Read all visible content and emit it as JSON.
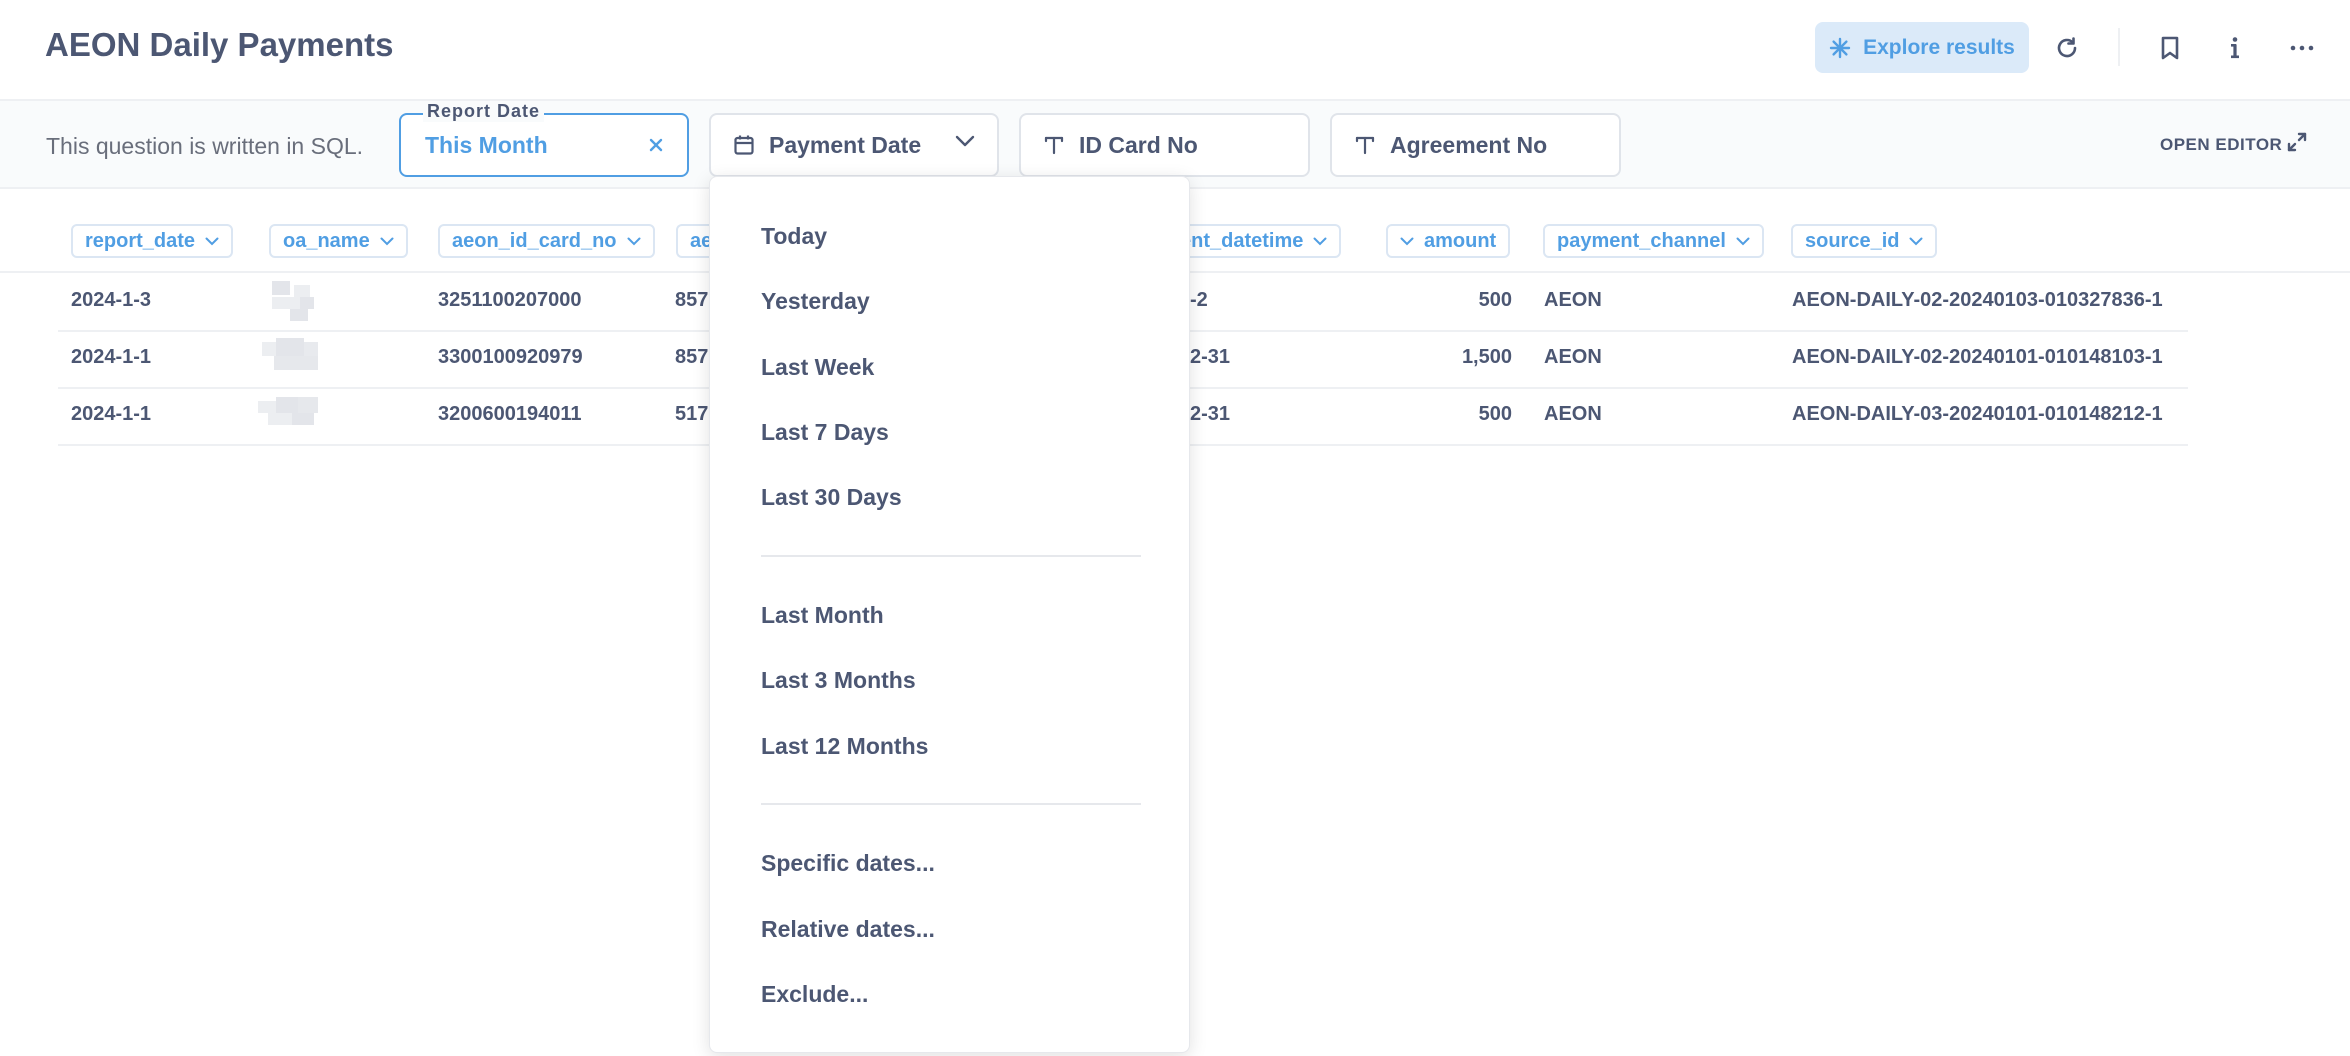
{
  "header": {
    "title": "AEON Daily Payments",
    "explore_label": "Explore results",
    "accent": "#509ee3"
  },
  "sqlbar": {
    "text": "This question is written in SQL.",
    "open_editor": "OPEN EDITOR",
    "filters": {
      "report_date": {
        "label": "Report Date",
        "value": "This Month"
      },
      "payment_date": {
        "label": "Payment Date"
      },
      "id_card": {
        "label": "ID Card No"
      },
      "agreement": {
        "label": "Agreement No"
      }
    }
  },
  "table": {
    "columns": [
      "report_date",
      "oa_name",
      "aeon_id_card_no",
      "ae",
      "ent_datetime",
      "amount",
      "payment_channel",
      "source_id"
    ],
    "rows": [
      {
        "report_date": "2024-1-3",
        "id_card": "3251100207000",
        "ae": "857",
        "datetime": "-2",
        "amount": "500",
        "channel": "AEON",
        "source_id": "AEON-DAILY-02-20240103-010327836-1"
      },
      {
        "report_date": "2024-1-1",
        "id_card": "3300100920979",
        "ae": "857",
        "datetime": "2-31",
        "amount": "1,500",
        "channel": "AEON",
        "source_id": "AEON-DAILY-02-20240101-010148103-1"
      },
      {
        "report_date": "2024-1-1",
        "id_card": "3200600194011",
        "ae": "517",
        "datetime": "2-31",
        "amount": "500",
        "channel": "AEON",
        "source_id": "AEON-DAILY-03-20240101-010148212-1"
      }
    ]
  },
  "dropdown": {
    "group1": [
      "Today",
      "Yesterday",
      "Last Week",
      "Last 7 Days",
      "Last 30 Days"
    ],
    "group2": [
      "Last Month",
      "Last 3 Months",
      "Last 12 Months"
    ],
    "group3": [
      "Specific dates...",
      "Relative dates...",
      "Exclude..."
    ]
  }
}
